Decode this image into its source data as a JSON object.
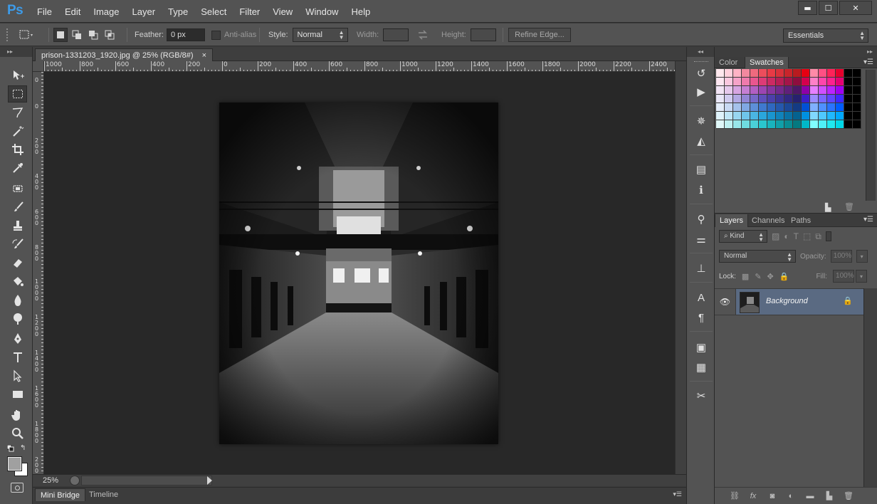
{
  "app": {
    "logo": "Ps"
  },
  "menu": [
    "File",
    "Edit",
    "Image",
    "Layer",
    "Type",
    "Select",
    "Filter",
    "View",
    "Window",
    "Help"
  ],
  "window_controls": {
    "minimize": "▬",
    "maximize": "☐",
    "close": "✕"
  },
  "options": {
    "feather_label": "Feather:",
    "feather_value": "0 px",
    "antialias_label": "Anti-alias",
    "style_label": "Style:",
    "style_value": "Normal",
    "width_label": "Width:",
    "height_label": "Height:",
    "refine_edge": "Refine Edge...",
    "workspace": "Essentials"
  },
  "document": {
    "tab_title": "prison-1331203_1920.jpg @ 25% (RGB/8#)",
    "tab_close": "×",
    "zoom": "25%",
    "ruler_top": [
      "1000",
      "800",
      "600",
      "400",
      "200",
      "0",
      "200",
      "400",
      "600",
      "800",
      "1000",
      "1200",
      "1400",
      "1600",
      "1800",
      "2000",
      "2200",
      "2400"
    ],
    "ruler_left": [
      "0",
      "0",
      "2 0 0",
      "4 0 0",
      "6 0 0",
      "8 0 0",
      "1 0 0 0",
      "1 2 0 0",
      "1 4 0 0",
      "1 6 0 0",
      "1 8 0 0",
      "2 0 0 0"
    ]
  },
  "bottom_tabs": {
    "mini_bridge": "Mini Bridge",
    "timeline": "Timeline"
  },
  "swatches_panel": {
    "tabs": [
      "Color",
      "Swatches"
    ],
    "active_tab": "Swatches",
    "colors": [
      "#ffe8ee",
      "#ffd0dc",
      "#ffb3c5",
      "#f2899f",
      "#ef6a7e",
      "#ec4d5c",
      "#e83a45",
      "#d8313a",
      "#c8252b",
      "#b81b1f",
      "#e60012",
      "#ff8aa8",
      "#ff4f84",
      "#ff2259",
      "#e6002d",
      "#000000",
      "#000000",
      "#fde6f1",
      "#fbc8df",
      "#f6a3c8",
      "#ef7bac",
      "#e9568f",
      "#dd3b76",
      "#cc2a63",
      "#b81e55",
      "#a41549",
      "#8e0d3e",
      "#d4004d",
      "#ff80c8",
      "#ff45ab",
      "#ff2090",
      "#e60073",
      "#000000",
      "#000000",
      "#f2e4f5",
      "#e6c9ec",
      "#d7a5e1",
      "#c67fd3",
      "#b25fc3",
      "#9c45b2",
      "#8635a0",
      "#732a8d",
      "#60207a",
      "#4e1866",
      "#8e00a8",
      "#e680ff",
      "#d050ff",
      "#bb24ff",
      "#a000f0",
      "#000000",
      "#000000",
      "#e8e6f7",
      "#d0cbef",
      "#b2a9e3",
      "#9286d5",
      "#7668c8",
      "#5e4fbb",
      "#4c3faa",
      "#3e3397",
      "#322983",
      "#27216f",
      "#3c1ec8",
      "#9b8cff",
      "#7a66ff",
      "#5f45ff",
      "#4028ff",
      "#000000",
      "#000000",
      "#e3ecf9",
      "#c8d9f3",
      "#a5c2eb",
      "#80a8e2",
      "#5d8fd9",
      "#3f79cf",
      "#2f68c0",
      "#2558ad",
      "#1c4999",
      "#143b84",
      "#0050d6",
      "#7fb0ff",
      "#4f90ff",
      "#2a74ff",
      "#005cff",
      "#000000",
      "#000000",
      "#dff3fb",
      "#bfe6f6",
      "#98d6f0",
      "#6fc5ea",
      "#4ab5e3",
      "#2aa6dc",
      "#1995cf",
      "#1083bb",
      "#0a72a5",
      "#05628f",
      "#0090e0",
      "#80d8ff",
      "#4fc8ff",
      "#20b8ff",
      "#00a8ff",
      "#000000",
      "#000000",
      "#dff7f8",
      "#bff0f1",
      "#98e6e9",
      "#6fdce0",
      "#4ad1d7",
      "#2ac6ce",
      "#19b4bd",
      "#10a0a9",
      "#0a8d94",
      "#057980",
      "#00b8c8",
      "#80ffff",
      "#4ff0f8",
      "#20e8f0",
      "#00d8e8",
      "#000000",
      "#000000"
    ]
  },
  "layers_panel": {
    "tabs": [
      "Layers",
      "Channels",
      "Paths"
    ],
    "active_tab": "Layers",
    "kind_label": "Kind",
    "blend_mode": "Normal",
    "opacity_label": "Opacity:",
    "opacity_value": "100%",
    "lock_label": "Lock:",
    "fill_label": "Fill:",
    "fill_value": "100%",
    "layer_name": "Background"
  }
}
